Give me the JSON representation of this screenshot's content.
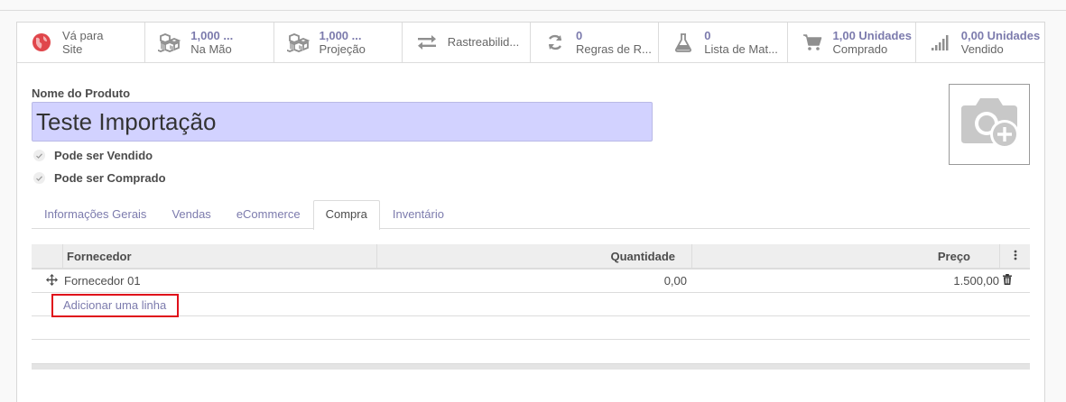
{
  "smart_buttons": [
    {
      "id": "website",
      "number": "",
      "label_line1": "Vá para",
      "label_line2": "Site",
      "icon": "globe-icon"
    },
    {
      "id": "on-hand",
      "number": "1,000 ...",
      "label_line2": "Na Mão",
      "icon": "cubes-icon"
    },
    {
      "id": "forecast",
      "number": "1,000 ...",
      "label_line2": "Projeção",
      "icon": "cubes-icon"
    },
    {
      "id": "traceability",
      "number": "",
      "label_line2": "Rastreabilid...",
      "icon": "exchange-arrows-icon"
    },
    {
      "id": "reorder-rules",
      "number": "0",
      "label_line2": "Regras de R...",
      "icon": "refresh-icon"
    },
    {
      "id": "bom",
      "number": "0",
      "label_line2": "Lista de Mat...",
      "icon": "flask-icon"
    },
    {
      "id": "purchased",
      "number": "1,00 Unidades",
      "label_line2": "Comprado",
      "icon": "cart-icon"
    },
    {
      "id": "sold",
      "number": "0,00 Unidades",
      "label_line2": "Vendido",
      "icon": "signal-bars-icon"
    }
  ],
  "product": {
    "name_label": "Nome do Produto",
    "name_value": "Teste Importação",
    "can_be_sold_label": "Pode ser Vendido",
    "can_be_purchased_label": "Pode ser Comprado"
  },
  "tabs": [
    {
      "label": "Informações Gerais",
      "active": false
    },
    {
      "label": "Vendas",
      "active": false
    },
    {
      "label": "eCommerce",
      "active": false
    },
    {
      "label": "Compra",
      "active": true
    },
    {
      "label": "Inventário",
      "active": false
    }
  ],
  "vendor_table": {
    "headers": {
      "vendor": "Fornecedor",
      "quantity": "Quantidade",
      "price": "Preço"
    },
    "rows": [
      {
        "vendor": "Fornecedor 01",
        "quantity": "0,00",
        "price": "1.500,00"
      }
    ],
    "add_line_label": "Adicionar uma linha"
  },
  "colors": {
    "accent": "#7c7bad",
    "input_bg": "#d2d2ff",
    "highlight_border": "#e0101a",
    "globe_red": "#e0464b"
  }
}
